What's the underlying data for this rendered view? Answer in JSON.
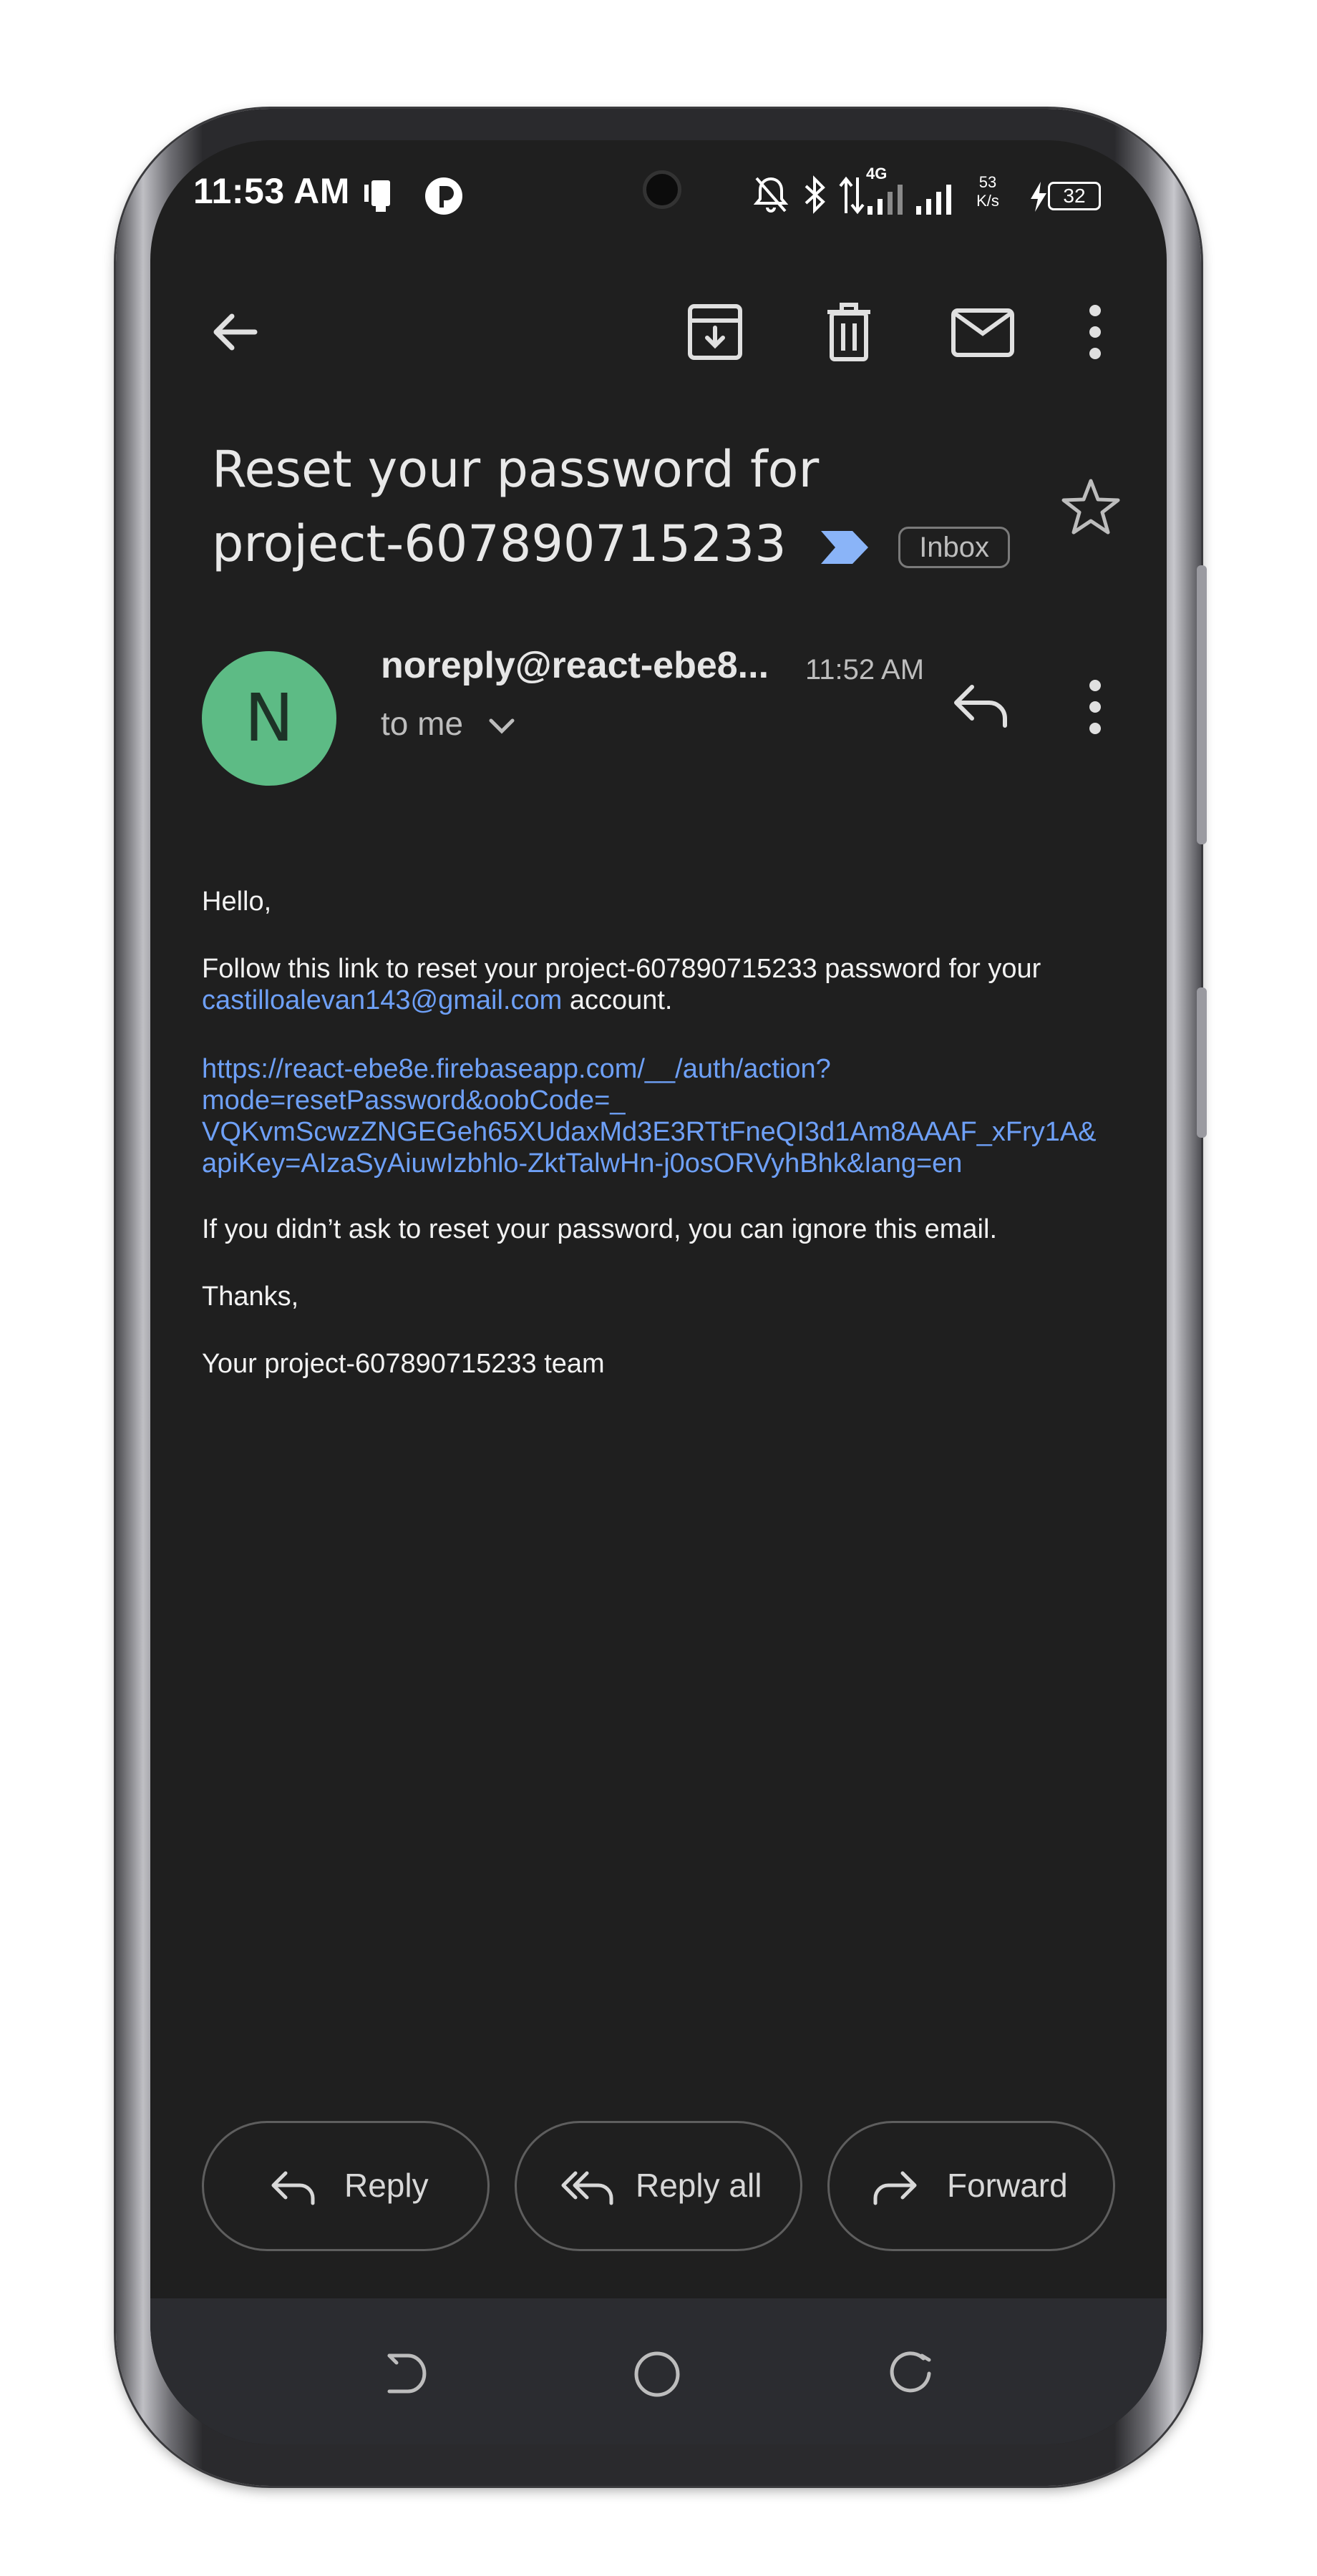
{
  "status_bar": {
    "time": "11:53 AM",
    "network_type": "4G",
    "speed_value": "53",
    "speed_unit": "K/s",
    "battery": "32"
  },
  "toolbar": {
    "icons": [
      "back-arrow-icon",
      "archive-icon",
      "delete-icon",
      "mark-unread-icon",
      "more-vert-icon"
    ]
  },
  "email": {
    "subject_line1": "Reset your password for",
    "subject_line2": "project-607890715233",
    "label": "Inbox",
    "sender": "noreply@react-ebe8...",
    "avatar_letter": "N",
    "time": "11:52 AM",
    "recipient": "to me",
    "greeting": "Hello,",
    "para1_text": "Follow this link to reset your project-607890715233 password for your",
    "para1_email": "castilloalevan143@gmail.com",
    "para1_tail": " account.",
    "reset_link_lines": [
      "https://react-ebe8e.firebaseapp.com/__/auth/action?",
      "mode=resetPassword&oobCode=_",
      "VQKvmScwzZNGEGeh65XUdaxMd3E3RTtFneQI3d1Am8AAAF_xFry1A&",
      "apiKey=AIzaSyAiuwIzbhlo-ZktTalwHn-j0osORVyhBhk&lang=en"
    ],
    "para2": "If you didn’t ask to reset your password, you can ignore this email.",
    "thanks": "Thanks,",
    "signoff": "Your project-607890715233 team"
  },
  "actions": {
    "reply": "Reply",
    "reply_all": "Reply all",
    "forward": "Forward"
  },
  "colors": {
    "background": "#1f1f1f",
    "link": "#6ea0f7",
    "avatar": "#5dbb85",
    "important_marker": "#8ab4f8"
  }
}
